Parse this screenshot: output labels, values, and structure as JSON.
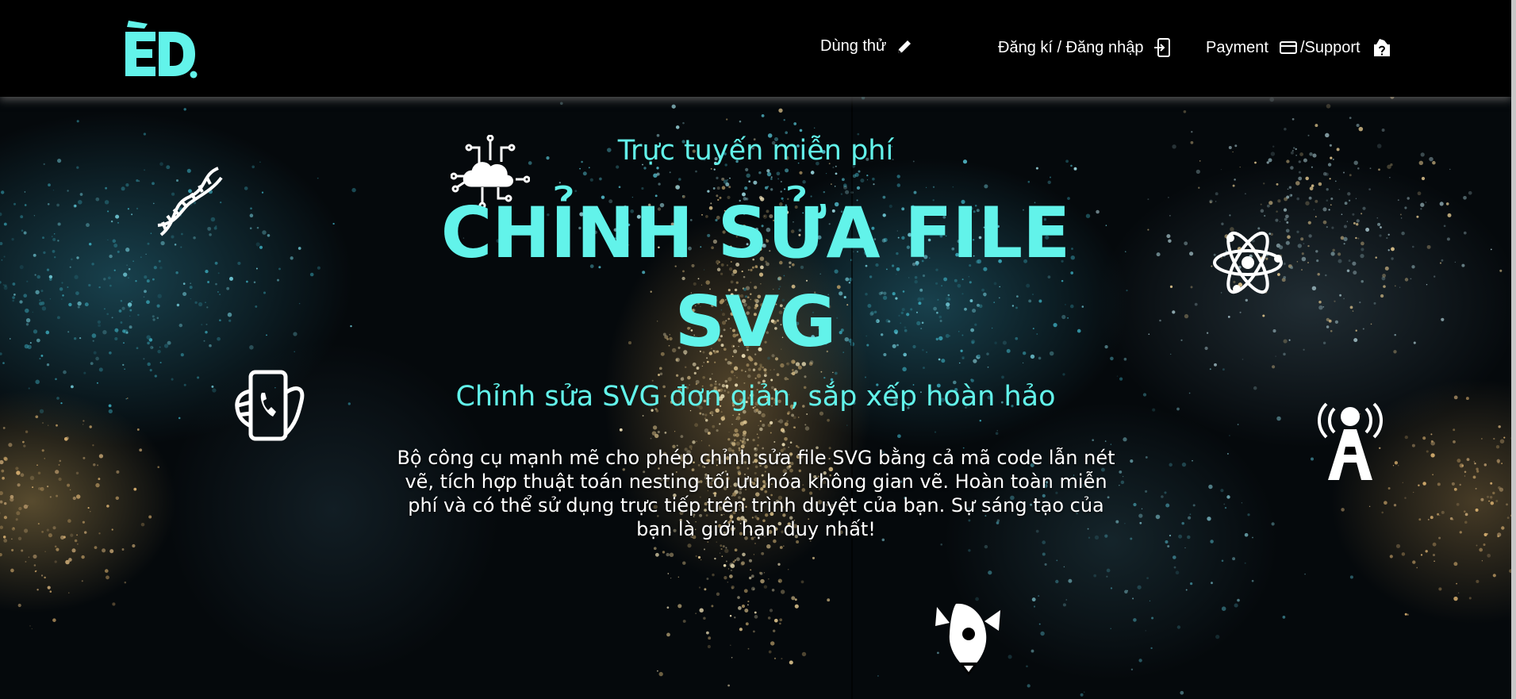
{
  "header": {
    "logo_text": "ED.",
    "nav": {
      "try_label": "Dùng thử",
      "auth_label": "Đăng kí / Đăng nhập",
      "payment_label": "Payment",
      "support_label": "/Support"
    }
  },
  "hero": {
    "eyebrow": "Trực tuyến miễn phí",
    "headline": "CHỈNH SỬA FILE SVG",
    "subheadline": "Chỉnh sửa SVG đơn giản, sắp xếp hoàn hảo",
    "description": "Bộ công cụ mạnh mẽ cho phép chỉnh sửa file SVG bằng cả mã code lẫn nét vẽ, tích hợp thuật toán nesting tối ưu hóa không gian vẽ. Hoàn toàn miễn phí và có thể sử dụng trực tiếp trên trình duyệt của bạn. Sự sáng tạo của bạn là giới hạn duy nhất!"
  },
  "decorative_icons": [
    "cloud-network-icon",
    "dna-icon",
    "atom-icon",
    "phone-in-hand-icon",
    "radio-tower-icon",
    "rocket-icon"
  ],
  "colors": {
    "accent": "#62f3ea",
    "background": "#000000",
    "text": "#ffffff"
  }
}
